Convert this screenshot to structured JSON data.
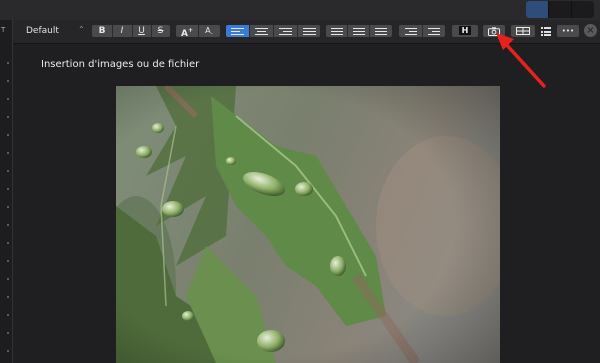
{
  "toolbar": {
    "paragraph_style": "Default",
    "format_buttons": [
      "B",
      "I",
      "U",
      "S"
    ],
    "font_size_buttons": [
      "A",
      "A"
    ],
    "header_button": "H",
    "more_button": "•••"
  },
  "sidebar": {
    "letter": "T"
  },
  "document": {
    "heading": "Insertion d'images ou de fichier"
  },
  "colors": {
    "accent": "#3a7bd5",
    "annotation_arrow": "#e8211d"
  }
}
